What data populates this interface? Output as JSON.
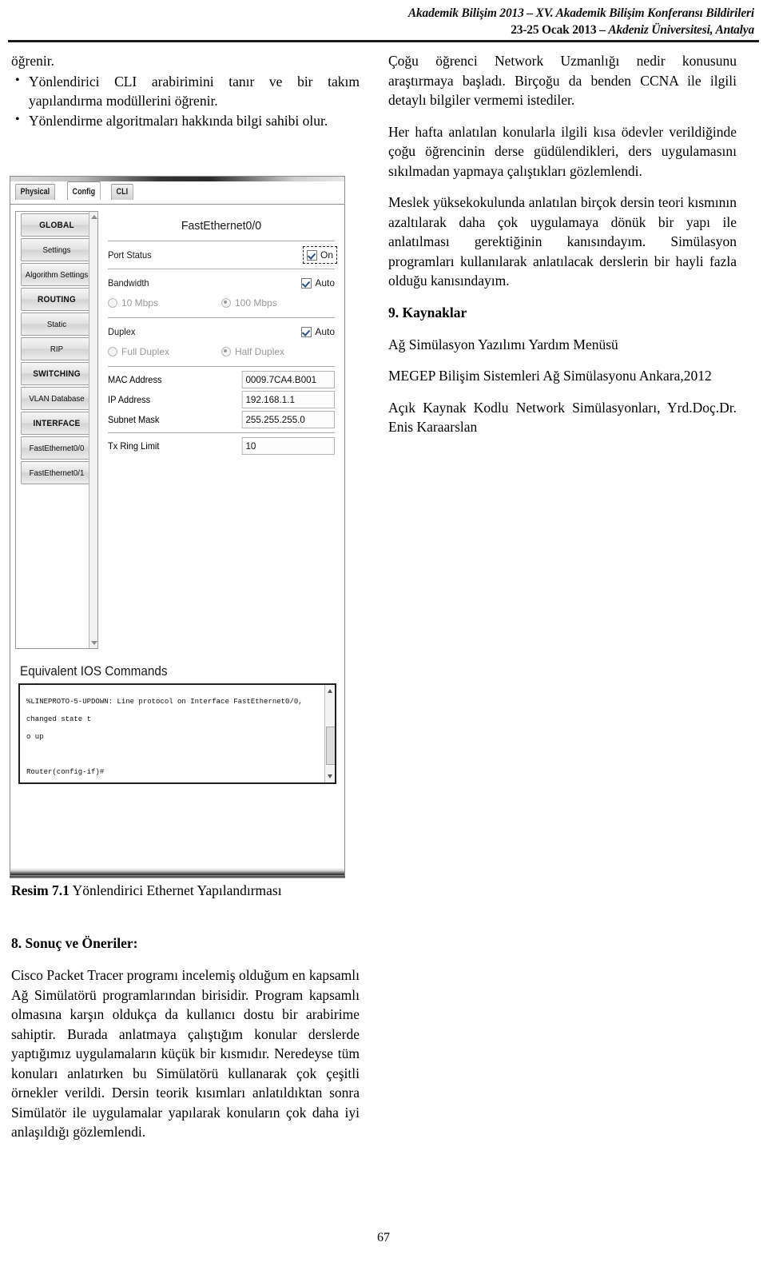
{
  "header": {
    "line1": "Akademik Bilişim 2013 – XV. Akademik Bilişim Konferansı Bildirileri",
    "line2_date": "23-25 Ocak 2013 – ",
    "line2_place": "Akdeniz Üniversitesi, Antalya"
  },
  "left_column": {
    "orphan_line": "öğrenir.",
    "bullets": [
      "Yönlendirici CLI arabirimini tanır ve bir takım yapılandırma modüllerini öğrenir.",
      "Yönlendirme algoritmaları hakkında bilgi sahibi olur."
    ]
  },
  "right_column": {
    "paragraphs": [
      "Çoğu öğrenci Network Uzmanlığı nedir konusunu araştırmaya başladı. Birçoğu da benden CCNA ile ilgili detaylı bilgiler vermemi istediler.",
      "Her hafta anlatılan konularla ilgili kısa ödevler verildiğinde çoğu öğrencinin derse güdülendikleri, ders uygulamasını sıkılmadan yapmaya çalıştıkları gözlemlendi.",
      "Meslek yüksekokulunda anlatılan birçok dersin teori kısmının azaltılarak daha çok uygulamaya dönük bir yapı ile anlatılması gerektiğinin kanısındayım. Simülasyon programları kullanılarak anlatılacak derslerin bir hayli fazla olduğu kanısındayım."
    ],
    "references_heading": "9. Kaynaklar",
    "references": [
      "Ağ Simülasyon Yazılımı Yardım Menüsü",
      "MEGEP Bilişim Sistemleri Ağ Simülasyonu Ankara,2012",
      "Açık Kaynak Kodlu Network Simülasyonları, Yrd.Doç.Dr. Enis Karaarslan"
    ]
  },
  "screenshot": {
    "tabs": [
      {
        "label": "Physical",
        "active": false
      },
      {
        "label": "Config",
        "active": true
      },
      {
        "label": "CLI",
        "active": false
      }
    ],
    "nav_items": [
      {
        "label": "GLOBAL",
        "header": true
      },
      {
        "label": "Settings",
        "header": false
      },
      {
        "label": "Algorithm Settings",
        "header": false
      },
      {
        "label": "ROUTING",
        "header": true
      },
      {
        "label": "Static",
        "header": false
      },
      {
        "label": "RIP",
        "header": false
      },
      {
        "label": "SWITCHING",
        "header": true
      },
      {
        "label": "VLAN Database",
        "header": false
      },
      {
        "label": "INTERFACE",
        "header": true
      },
      {
        "label": "FastEthernet0/0",
        "header": false
      },
      {
        "label": "FastEthernet0/1",
        "header": false
      }
    ],
    "interface_title": "FastEthernet0/0",
    "port_status": {
      "label": "Port Status",
      "toggle_label": "On",
      "checked": true
    },
    "bandwidth": {
      "label": "Bandwidth",
      "auto_label": "Auto",
      "auto_checked": true,
      "options": [
        {
          "label": "10 Mbps",
          "selected": false
        },
        {
          "label": "100 Mbps",
          "selected": true
        }
      ]
    },
    "duplex": {
      "label": "Duplex",
      "auto_label": "Auto",
      "auto_checked": true,
      "options": [
        {
          "label": "Full Duplex",
          "selected": false
        },
        {
          "label": "Half Duplex",
          "selected": true
        }
      ]
    },
    "fields": [
      {
        "label": "MAC Address",
        "value": "0009.7CA4.B001"
      },
      {
        "label": "IP Address",
        "value": "192.168.1.1"
      },
      {
        "label": "Subnet Mask",
        "value": "255.255.255.0"
      },
      {
        "label": "Tx Ring Limit",
        "value": "10"
      }
    ],
    "ios": {
      "title": "Equivalent IOS Commands",
      "line1": "%LINEPROTO-5-UPDOWN: Line protocol on Interface FastEthernet0/0, changed state t",
      "line2": "o up",
      "line3": "Router(config-if)#"
    }
  },
  "figure_caption": {
    "number": "Resim 7.1",
    "text": " Yönlendirici Ethernet Yapılandırması"
  },
  "closing": {
    "heading": "8. Sonuç ve Öneriler:",
    "paragraph": "Cisco Packet Tracer programı incelemiş olduğum en kapsamlı Ağ Simülatörü programlarından birisidir. Program kapsamlı olmasına karşın oldukça da kullanıcı dostu bir arabirime sahiptir. Burada anlatmaya çalıştığım konular derslerde yaptığımız uygulamaların küçük bir kısmıdır. Neredeyse tüm konuları anlatırken bu Simülatörü kullanarak çok çeşitli örnekler verildi. Dersin teorik kısımları anlatıldıktan sonra Simülatör ile uygulamalar yapılarak konuların çok daha iyi anlaşıldığı gözlemlendi."
  },
  "page_number": "67"
}
